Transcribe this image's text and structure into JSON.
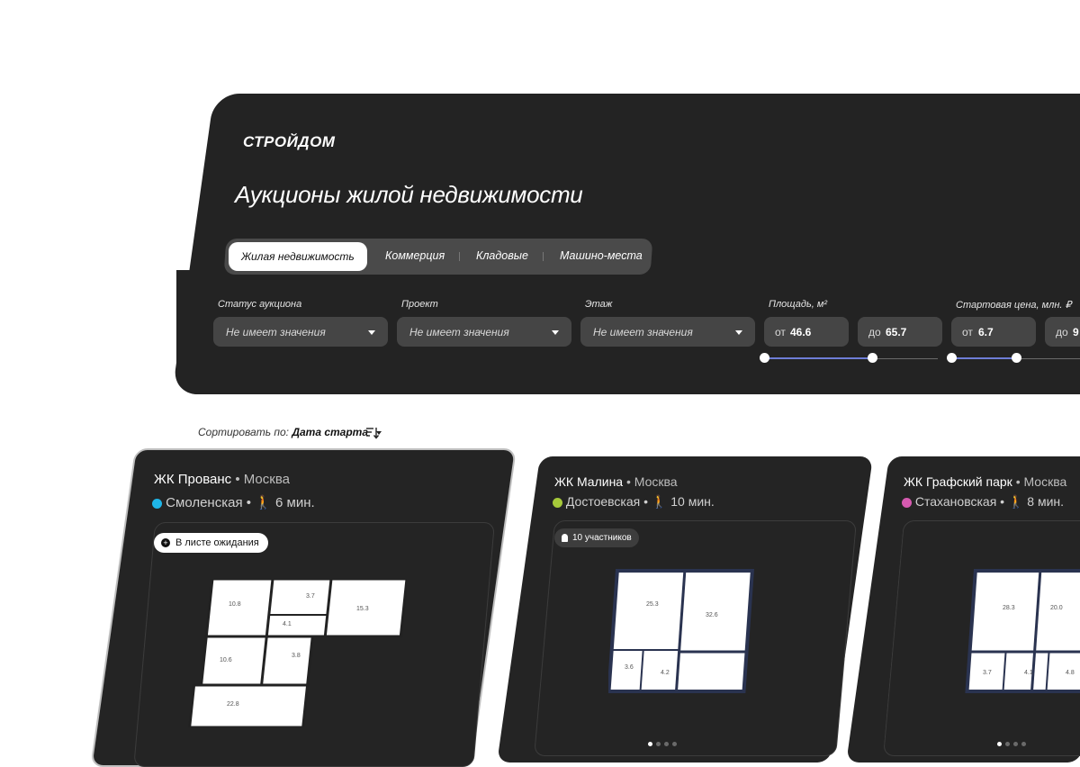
{
  "brand": {
    "logo": "СТРОЙДОМ"
  },
  "page": {
    "title": "Аукционы жилой недвижимости"
  },
  "tabs": [
    {
      "label": "Жилая недвижимость",
      "active": true
    },
    {
      "label": "Коммерция",
      "active": false
    },
    {
      "label": "Кладовые",
      "active": false
    },
    {
      "label": "Машино-места",
      "active": false
    }
  ],
  "filters": {
    "status": {
      "label": "Статус аукциона",
      "value": "Не имеет значения"
    },
    "project": {
      "label": "Проект",
      "value": "Не имеет значения"
    },
    "floor": {
      "label": "Этаж",
      "value": "Не имеет значения"
    },
    "area": {
      "label": "Площадь, м²",
      "from_prefix": "от",
      "from": "46.6",
      "to_prefix": "до",
      "to": "65.7"
    },
    "price": {
      "label": "Стартовая цена, млн. ₽",
      "from_prefix": "от",
      "from": "6.7",
      "to_prefix": "до",
      "to": "9"
    }
  },
  "sort": {
    "prefix": "Сортировать по:",
    "value": "Дата старта"
  },
  "cards": [
    {
      "name": "ЖК Прованс",
      "city": "• Москва",
      "metro": "Смоленская",
      "metro_color": "#1fb6e8",
      "walk": "6 мин.",
      "badge": "В листе ожидания",
      "rooms": [
        "10.8",
        "3.7",
        "15.3",
        "4.1",
        "10.6",
        "3.8",
        "22.8"
      ]
    },
    {
      "name": "ЖК Малина",
      "city": "• Москва",
      "metro": "Достоевская",
      "metro_color": "#a6c93a",
      "walk": "10 мин.",
      "badge": "10 участников",
      "rooms": [
        "25.3",
        "32.6",
        "3.6",
        "4.2"
      ]
    },
    {
      "name": "ЖК Графский парк",
      "city": "• Москва",
      "metro": "Стахановская",
      "metro_color": "#d65ab0",
      "walk": "8 мин.",
      "rooms": [
        "28.3",
        "20.0",
        "3.7",
        "4.1",
        "4.8"
      ]
    }
  ]
}
